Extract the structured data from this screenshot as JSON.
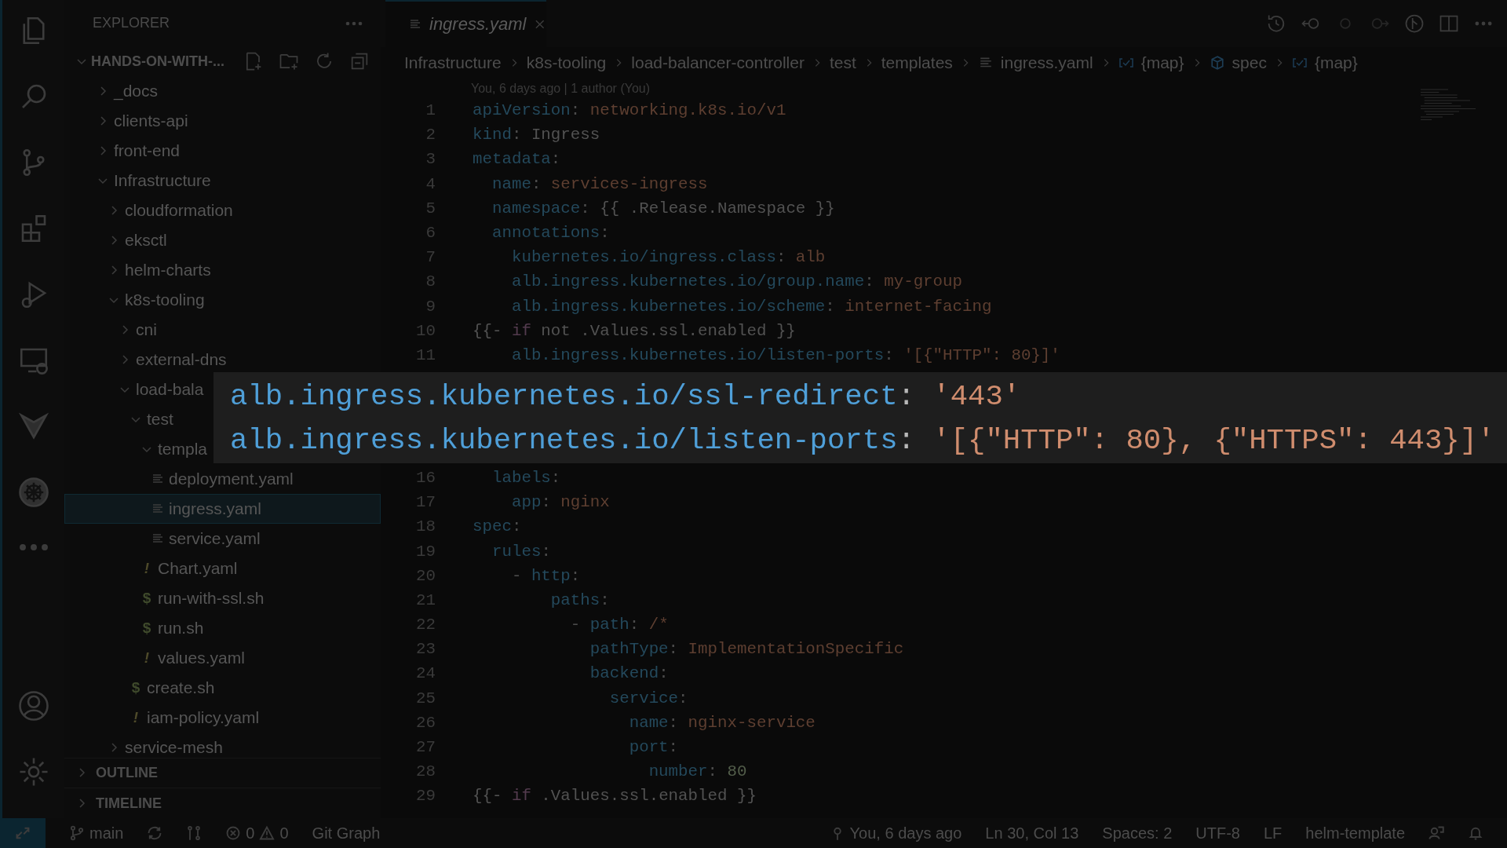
{
  "sidebar": {
    "title": "EXPLORER",
    "root": {
      "label": "HANDS-ON-WITH-...",
      "expanded": true
    },
    "tree": [
      {
        "label": "_docs",
        "kind": "folder",
        "expanded": false,
        "selected": false
      },
      {
        "label": "clients-api",
        "kind": "folder",
        "expanded": false,
        "selected": false
      },
      {
        "label": "front-end",
        "kind": "folder",
        "expanded": false,
        "selected": false
      },
      {
        "label": "Infrastructure",
        "kind": "folder",
        "expanded": true,
        "selected": false,
        "children": [
          {
            "label": "cloudformation",
            "kind": "folder",
            "expanded": false,
            "selected": false
          },
          {
            "label": "eksctl",
            "kind": "folder",
            "expanded": false,
            "selected": false
          },
          {
            "label": "helm-charts",
            "kind": "folder",
            "expanded": false,
            "selected": false
          },
          {
            "label": "k8s-tooling",
            "kind": "folder",
            "expanded": true,
            "selected": false,
            "children": [
              {
                "label": "cni",
                "kind": "folder",
                "expanded": false,
                "selected": false
              },
              {
                "label": "external-dns",
                "kind": "folder",
                "expanded": false,
                "selected": false
              },
              {
                "label": "load-bala",
                "kind": "folder",
                "expanded": true,
                "selected": false,
                "children": [
                  {
                    "label": "test",
                    "kind": "folder",
                    "expanded": true,
                    "selected": false,
                    "children": [
                      {
                        "label": "templa",
                        "kind": "folder",
                        "expanded": true,
                        "selected": false,
                        "children": [
                          {
                            "label": "deployment.yaml",
                            "kind": "doc",
                            "selected": false
                          },
                          {
                            "label": "ingress.yaml",
                            "kind": "doc",
                            "selected": true
                          },
                          {
                            "label": "service.yaml",
                            "kind": "doc",
                            "selected": false
                          }
                        ]
                      },
                      {
                        "label": "Chart.yaml",
                        "kind": "glyph",
                        "glyph": "!",
                        "selected": false
                      },
                      {
                        "label": "run-with-ssl.sh",
                        "kind": "glyph",
                        "glyph": "$",
                        "selected": false
                      },
                      {
                        "label": "run.sh",
                        "kind": "glyph",
                        "glyph": "$",
                        "selected": false
                      },
                      {
                        "label": "values.yaml",
                        "kind": "glyph",
                        "glyph": "!",
                        "selected": false
                      }
                    ]
                  },
                  {
                    "label": "create.sh",
                    "kind": "glyph",
                    "glyph": "$",
                    "selected": false
                  },
                  {
                    "label": "iam-policy.yaml",
                    "kind": "glyph",
                    "glyph": "!",
                    "selected": false
                  }
                ]
              }
            ]
          },
          {
            "label": "service-mesh",
            "kind": "folder",
            "expanded": false,
            "selected": false
          }
        ]
      }
    ],
    "sections": [
      {
        "label": "OUTLINE",
        "expanded": false
      },
      {
        "label": "TIMELINE",
        "expanded": false
      }
    ]
  },
  "tab": {
    "label": "ingress.yaml"
  },
  "breadcrumbs": [
    {
      "label": "Infrastructure",
      "kind": "folder"
    },
    {
      "label": "k8s-tooling",
      "kind": "folder"
    },
    {
      "label": "load-balancer-controller",
      "kind": "folder"
    },
    {
      "label": "test",
      "kind": "folder"
    },
    {
      "label": "templates",
      "kind": "folder"
    },
    {
      "label": "ingress.yaml",
      "kind": "file"
    },
    {
      "label": "{map}",
      "kind": "map"
    },
    {
      "label": "spec",
      "kind": "module"
    },
    {
      "label": "{map}",
      "kind": "map"
    }
  ],
  "blame": "You, 6 days ago | 1 author (You)",
  "code": [
    {
      "number": "1",
      "tokens": [
        {
          "kind": "key",
          "text": "apiVersion"
        },
        {
          "kind": "punct",
          "text": ": "
        },
        {
          "kind": "value",
          "text": "networking.k8s.io/v1"
        }
      ]
    },
    {
      "number": "2",
      "tokens": [
        {
          "kind": "key",
          "text": "kind"
        },
        {
          "kind": "punct",
          "text": ": "
        },
        {
          "kind": "plain",
          "text": "Ingress"
        }
      ]
    },
    {
      "number": "3",
      "tokens": [
        {
          "kind": "key",
          "text": "metadata"
        },
        {
          "kind": "punct",
          "text": ":"
        }
      ]
    },
    {
      "number": "4",
      "tokens": [
        {
          "kind": "key",
          "text": "  name"
        },
        {
          "kind": "punct",
          "text": ": "
        },
        {
          "kind": "value",
          "text": "services-ingress"
        }
      ]
    },
    {
      "number": "5",
      "tokens": [
        {
          "kind": "key",
          "text": "  namespace"
        },
        {
          "kind": "punct",
          "text": ": "
        },
        {
          "kind": "plain",
          "text": "{{ .Release.Namespace }}"
        }
      ]
    },
    {
      "number": "6",
      "tokens": [
        {
          "kind": "key",
          "text": "  annotations"
        },
        {
          "kind": "punct",
          "text": ":"
        }
      ]
    },
    {
      "number": "7",
      "tokens": [
        {
          "kind": "key",
          "text": "    kubernetes.io/ingress.class"
        },
        {
          "kind": "punct",
          "text": ": "
        },
        {
          "kind": "value",
          "text": "alb"
        }
      ]
    },
    {
      "number": "8",
      "tokens": [
        {
          "kind": "key",
          "text": "    alb.ingress.kubernetes.io/group.name"
        },
        {
          "kind": "punct",
          "text": ": "
        },
        {
          "kind": "value",
          "text": "my-group"
        }
      ]
    },
    {
      "number": "9",
      "tokens": [
        {
          "kind": "key",
          "text": "    alb.ingress.kubernetes.io/scheme"
        },
        {
          "kind": "punct",
          "text": ": "
        },
        {
          "kind": "value",
          "text": "internet-facing"
        }
      ]
    },
    {
      "number": "10",
      "tokens": [
        {
          "kind": "plain",
          "text": "{{- "
        },
        {
          "kind": "keyword",
          "text": "if"
        },
        {
          "kind": "plain",
          "text": " not .Values.ssl.enabled }}"
        }
      ]
    },
    {
      "number": "11",
      "tokens": [
        {
          "kind": "key",
          "text": "    alb.ingress.kubernetes.io/listen-ports"
        },
        {
          "kind": "punct",
          "text": ": "
        },
        {
          "kind": "value",
          "text": "'[{\"HTTP\": 80}]'"
        }
      ]
    },
    {
      "number": "16",
      "tokens": [
        {
          "kind": "key",
          "text": "  labels"
        },
        {
          "kind": "punct",
          "text": ":"
        }
      ]
    },
    {
      "number": "17",
      "tokens": [
        {
          "kind": "key",
          "text": "    app"
        },
        {
          "kind": "punct",
          "text": ": "
        },
        {
          "kind": "value",
          "text": "nginx"
        }
      ]
    },
    {
      "number": "18",
      "tokens": [
        {
          "kind": "key",
          "text": "spec"
        },
        {
          "kind": "punct",
          "text": ":"
        }
      ]
    },
    {
      "number": "19",
      "tokens": [
        {
          "kind": "key",
          "text": "  rules"
        },
        {
          "kind": "punct",
          "text": ":"
        }
      ]
    },
    {
      "number": "20",
      "tokens": [
        {
          "kind": "punct",
          "text": "    - "
        },
        {
          "kind": "key",
          "text": "http"
        },
        {
          "kind": "punct",
          "text": ":"
        }
      ]
    },
    {
      "number": "21",
      "tokens": [
        {
          "kind": "key",
          "text": "        paths"
        },
        {
          "kind": "punct",
          "text": ":"
        }
      ]
    },
    {
      "number": "22",
      "tokens": [
        {
          "kind": "punct",
          "text": "          - "
        },
        {
          "kind": "key",
          "text": "path"
        },
        {
          "kind": "punct",
          "text": ": "
        },
        {
          "kind": "value",
          "text": "/*"
        }
      ]
    },
    {
      "number": "23",
      "tokens": [
        {
          "kind": "key",
          "text": "            pathType"
        },
        {
          "kind": "punct",
          "text": ": "
        },
        {
          "kind": "value",
          "text": "ImplementationSpecific"
        }
      ]
    },
    {
      "number": "24",
      "tokens": [
        {
          "kind": "key",
          "text": "            backend"
        },
        {
          "kind": "punct",
          "text": ":"
        }
      ]
    },
    {
      "number": "25",
      "tokens": [
        {
          "kind": "key",
          "text": "              service"
        },
        {
          "kind": "punct",
          "text": ":"
        }
      ]
    },
    {
      "number": "26",
      "tokens": [
        {
          "kind": "key",
          "text": "                name"
        },
        {
          "kind": "punct",
          "text": ": "
        },
        {
          "kind": "value",
          "text": "nginx-service"
        }
      ]
    },
    {
      "number": "27",
      "tokens": [
        {
          "kind": "key",
          "text": "                port"
        },
        {
          "kind": "punct",
          "text": ":"
        }
      ]
    },
    {
      "number": "28",
      "tokens": [
        {
          "kind": "key",
          "text": "                  number"
        },
        {
          "kind": "punct",
          "text": ": "
        },
        {
          "kind": "number",
          "text": "80"
        }
      ]
    },
    {
      "number": "29",
      "tokens": [
        {
          "kind": "plain",
          "text": "{{- "
        },
        {
          "kind": "keyword",
          "text": "if"
        },
        {
          "kind": "plain",
          "text": " .Values.ssl.enabled }}"
        }
      ]
    }
  ],
  "zoom_overlay": [
    {
      "tokens": [
        {
          "kind": "key",
          "text": "alb.ingress.kubernetes.io/ssl-redirect"
        },
        {
          "kind": "punct",
          "text": ": "
        },
        {
          "kind": "value",
          "text": "'443'"
        }
      ]
    },
    {
      "tokens": [
        {
          "kind": "key",
          "text": "alb.ingress.kubernetes.io/listen-ports"
        },
        {
          "kind": "punct",
          "text": ": "
        },
        {
          "kind": "value",
          "text": "'[{\"HTTP\": 80}, {\"HTTPS\": 443}]'"
        }
      ]
    }
  ],
  "status_bar": {
    "branch": "main",
    "errors": "0",
    "warnings": "0",
    "git_graph": "Git Graph",
    "blame": "You, 6 days ago",
    "position": "Ln 30, Col 13",
    "spaces": "Spaces: 2",
    "encoding": "UTF-8",
    "eol": "LF",
    "language": "helm-template"
  }
}
